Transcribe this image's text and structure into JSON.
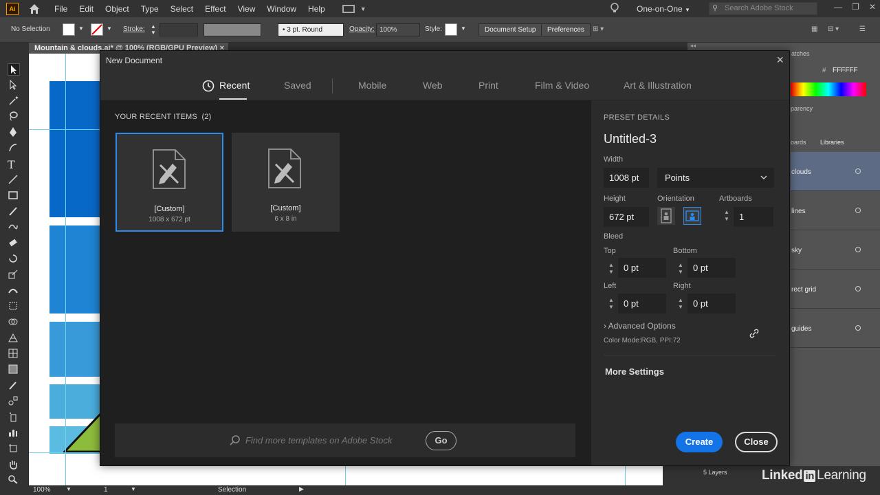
{
  "menubar": {
    "app_badge": "Ai",
    "items": [
      "File",
      "Edit",
      "Object",
      "Type",
      "Select",
      "Effect",
      "View",
      "Window",
      "Help"
    ],
    "workspace": "One-on-One",
    "search_placeholder": "Search Adobe Stock"
  },
  "controlbar": {
    "selection": "No Selection",
    "stroke_label": "Stroke:",
    "brush": "3 pt. Round",
    "opacity_label": "Opacity:",
    "opacity_value": "100%",
    "style_label": "Style:",
    "document_setup": "Document Setup",
    "preferences": "Preferences"
  },
  "document_tab": {
    "title": "Mountain & clouds.ai* @ 100% (RGB/GPU Preview)",
    "close": "×"
  },
  "right_panel": {
    "swatches_header": "atches",
    "hex_value": "FFFFFF",
    "transparency_header": "parency",
    "tabs": [
      "oards",
      "Libraries"
    ],
    "layers": [
      "clouds",
      "lines",
      "sky",
      "rect grid",
      "guides"
    ],
    "layers_count": "5 Layers"
  },
  "statusbar": {
    "zoom": "100%",
    "artboard": "1",
    "tool": "Selection"
  },
  "dialog": {
    "title": "New Document",
    "close": "×",
    "tabs": [
      "Recent",
      "Saved",
      "Mobile",
      "Web",
      "Print",
      "Film & Video",
      "Art & Illustration"
    ],
    "recent_label": "YOUR RECENT ITEMS",
    "recent_count": "(2)",
    "recent_items": [
      {
        "name": "[Custom]",
        "size": "1008 x 672 pt"
      },
      {
        "name": "[Custom]",
        "size": "6 x 8 in"
      }
    ],
    "stock_placeholder": "Find more templates on Adobe Stock",
    "go_label": "Go",
    "preset": {
      "header": "PRESET DETAILS",
      "name": "Untitled-3",
      "width_label": "Width",
      "width_value": "1008 pt",
      "units": "Points",
      "height_label": "Height",
      "height_value": "672 pt",
      "orientation_label": "Orientation",
      "artboards_label": "Artboards",
      "artboards_value": "1",
      "bleed_label": "Bleed",
      "top_label": "Top",
      "top_value": "0 pt",
      "bottom_label": "Bottom",
      "bottom_value": "0 pt",
      "left_label": "Left",
      "left_value": "0 pt",
      "right_label": "Right",
      "right_value": "0 pt",
      "advanced_options": "Advanced Options",
      "color_mode": "Color Mode:RGB, PPI:72",
      "more_settings": "More Settings"
    },
    "create_label": "Create",
    "close_label": "Close"
  },
  "watermark": {
    "linked": "Linked",
    "in": "in",
    "learning": "Learning"
  },
  "colors": {
    "accent": "#1473e6",
    "selection": "#2d8ceb",
    "dialog_bg": "#1f1f1f"
  }
}
